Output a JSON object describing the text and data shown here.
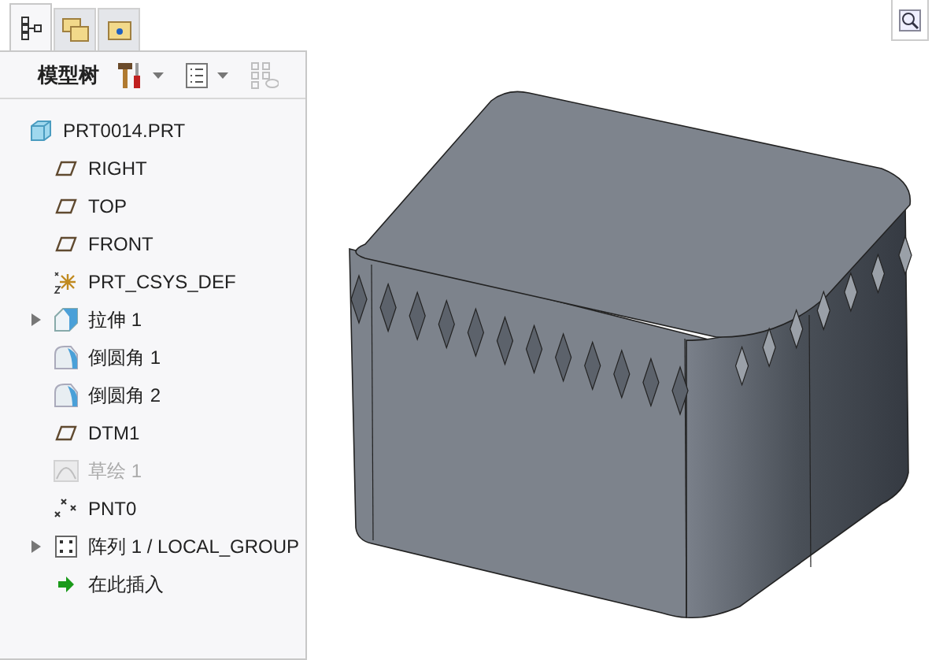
{
  "tabs": [
    {
      "selected": true
    },
    {
      "selected": false
    },
    {
      "selected": false
    }
  ],
  "toolbar": {
    "title": "模型树",
    "show_button": {
      "disabled": true
    }
  },
  "tree": [
    {
      "label": "PRT0014.PRT",
      "kind": "part"
    },
    {
      "label": "RIGHT",
      "kind": "plane"
    },
    {
      "label": "TOP",
      "kind": "plane"
    },
    {
      "label": "FRONT",
      "kind": "plane"
    },
    {
      "label": "PRT_CSYS_DEF",
      "kind": "csys"
    },
    {
      "label": "拉伸 1",
      "kind": "extrude",
      "expanded": false
    },
    {
      "label": "倒圆角 1",
      "kind": "round"
    },
    {
      "label": "倒圆角 2",
      "kind": "round"
    },
    {
      "label": "DTM1",
      "kind": "plane"
    },
    {
      "label": "草绘 1",
      "kind": "sketch",
      "disabled": true
    },
    {
      "label": "PNT0",
      "kind": "point"
    },
    {
      "label": "阵列 1 / LOCAL_GROUP",
      "kind": "pattern",
      "expanded": false
    },
    {
      "label": "在此插入",
      "kind": "insert"
    }
  ]
}
